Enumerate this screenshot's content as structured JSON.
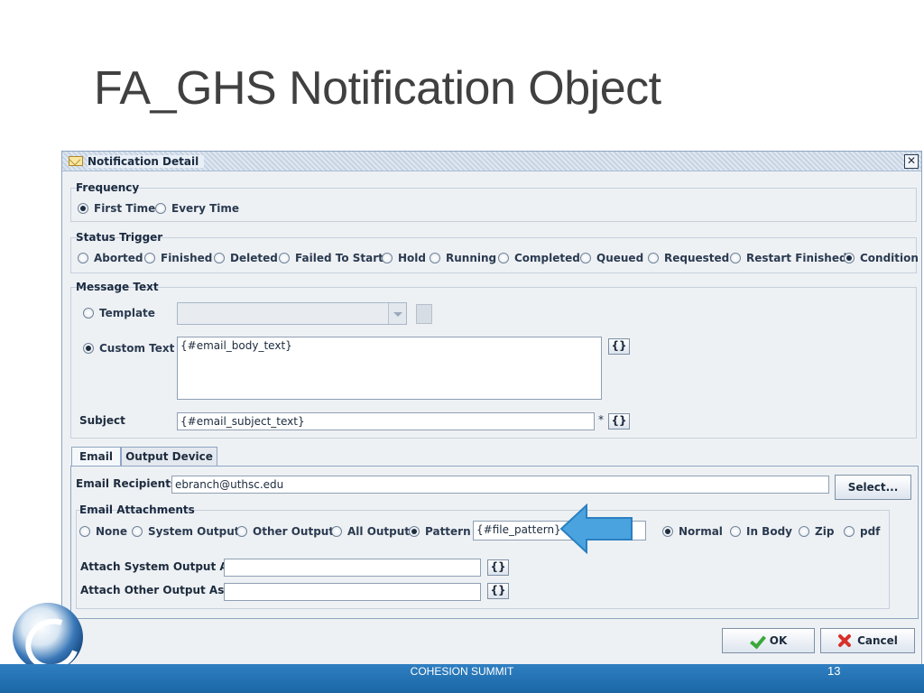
{
  "slide": {
    "title": "FA_GHS Notification Object",
    "footer": "COHESION SUMMIT",
    "page_number": "13"
  },
  "dialog": {
    "title": "Notification Detail",
    "close_glyph": "✕",
    "frequency": {
      "label": "Frequency",
      "options": [
        "First Time",
        "Every Time"
      ],
      "selected": "First Time"
    },
    "status_trigger": {
      "label": "Status Trigger",
      "options": [
        "Aborted",
        "Finished",
        "Deleted",
        "Failed To Start",
        "Hold",
        "Running",
        "Completed",
        "Queued",
        "Requested",
        "Restart Finished",
        "Condition"
      ],
      "selected": "Condition"
    },
    "message_text": {
      "label": "Message Text",
      "template_label": "Template",
      "template_value": "",
      "custom_text_label": "Custom Text",
      "custom_text_value": "{#email_body_text}",
      "subject_label": "Subject",
      "subject_value": "{#email_subject_text}",
      "required_marker": "*",
      "brace_glyph": "{}",
      "selected": "Custom Text"
    },
    "tabs": [
      "Email",
      "Output Device"
    ],
    "active_tab": "Email",
    "email": {
      "recipients_label": "Email Recipients",
      "recipients_value": "ebranch@uthsc.edu",
      "select_button": "Select...",
      "attachments": {
        "label": "Email Attachments",
        "options": [
          "None",
          "System Output",
          "Other Output",
          "All Output",
          "Pattern"
        ],
        "selected": "Pattern",
        "pattern_value": "{#file_pattern}",
        "format_options": [
          "Normal",
          "In Body",
          "Zip",
          "pdf"
        ],
        "format_selected": "Normal"
      },
      "attach_system_label": "Attach System Output As",
      "attach_system_value": "",
      "attach_other_label": "Attach Other Output As",
      "attach_other_value": ""
    },
    "buttons": {
      "ok": "OK",
      "cancel": "Cancel"
    }
  },
  "colors": {
    "arrow": "#4aa3df",
    "footer_bar": "#2573b5"
  }
}
